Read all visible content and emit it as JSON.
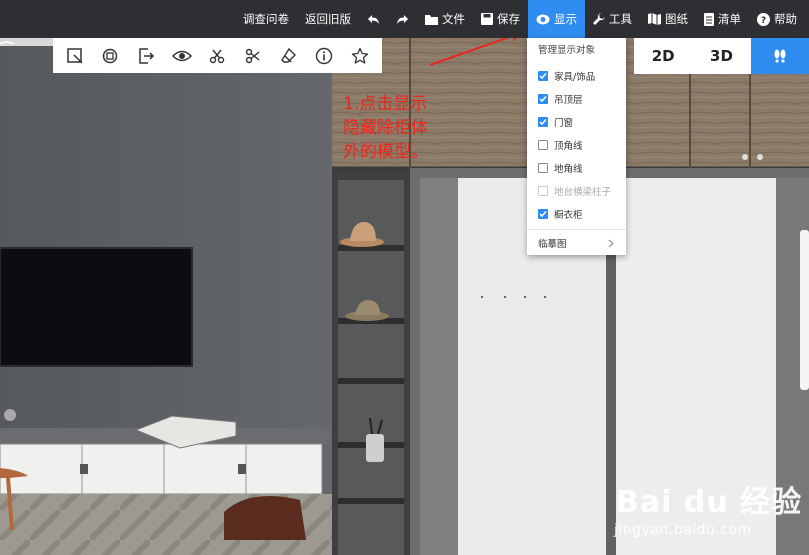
{
  "topbar": {
    "items": [
      {
        "label": "调查问卷",
        "icon": ""
      },
      {
        "label": "返回旧版",
        "icon": ""
      },
      {
        "label": "",
        "icon": "undo-icon"
      },
      {
        "label": "",
        "icon": "redo-icon"
      },
      {
        "label": "文件",
        "icon": "folder-icon"
      },
      {
        "label": "保存",
        "icon": "save-icon"
      },
      {
        "label": "显示",
        "icon": "eye-icon"
      },
      {
        "label": "工具",
        "icon": "wrench-icon"
      },
      {
        "label": "图纸",
        "icon": "map-icon"
      },
      {
        "label": "清单",
        "icon": "list-icon"
      },
      {
        "label": "帮助",
        "icon": "help-icon"
      }
    ],
    "active_color": "#2f8cf0"
  },
  "edit_toolbar": {
    "icons": [
      "select-box-icon",
      "rotate-icon",
      "exit-icon",
      "eye-icon",
      "cut-icon",
      "split-icon",
      "eraser-icon",
      "info-icon",
      "star-icon"
    ]
  },
  "view_toggle": {
    "options": [
      "2D",
      "3D"
    ],
    "active_icon": "footprints-icon"
  },
  "display_menu": {
    "header": "管理显示对象",
    "items": [
      {
        "label": "家具/饰品",
        "checked": true,
        "disabled": false
      },
      {
        "label": "吊顶层",
        "checked": true,
        "disabled": false
      },
      {
        "label": "门窗",
        "checked": true,
        "disabled": false
      },
      {
        "label": "顶角线",
        "checked": false,
        "disabled": false
      },
      {
        "label": "地角线",
        "checked": false,
        "disabled": false
      },
      {
        "label": "地台横梁柱子",
        "checked": false,
        "disabled": true
      },
      {
        "label": "橱衣柜",
        "checked": true,
        "disabled": false
      }
    ],
    "submenu": "临摹图"
  },
  "annotation": {
    "line1": "1.点击显示",
    "line2": "隐藏除柜体",
    "line3": "外的模型。",
    "color": "#e8281e"
  },
  "watermark": {
    "brand": "Bai du 经验",
    "url": "jingyan.baidu.com"
  }
}
